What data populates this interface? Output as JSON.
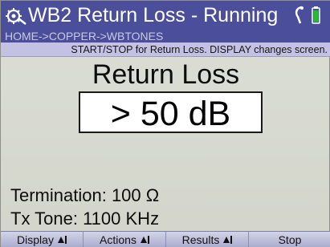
{
  "title": "WB2 Return Loss - Running",
  "breadcrumb": "HOME->COPPER->WBTONES",
  "hint": "START/STOP for Return Loss. DISPLAY changes screen.",
  "measurement": {
    "label": "Return Loss",
    "value": "> 50 dB"
  },
  "info": {
    "termination": "Termination: 100 Ω",
    "tx_tone": "Tx Tone: 1100 KHz"
  },
  "softkeys": [
    "Display",
    "Actions",
    "Results",
    "Stop"
  ],
  "icons": {
    "title": "settings-gear-icon",
    "probe": "test-lead-icon",
    "battery": "battery-icon"
  },
  "colors": {
    "titlebar": "#4b4f9b",
    "hintbar": "#c4c2e4",
    "battery": "#22c020"
  }
}
